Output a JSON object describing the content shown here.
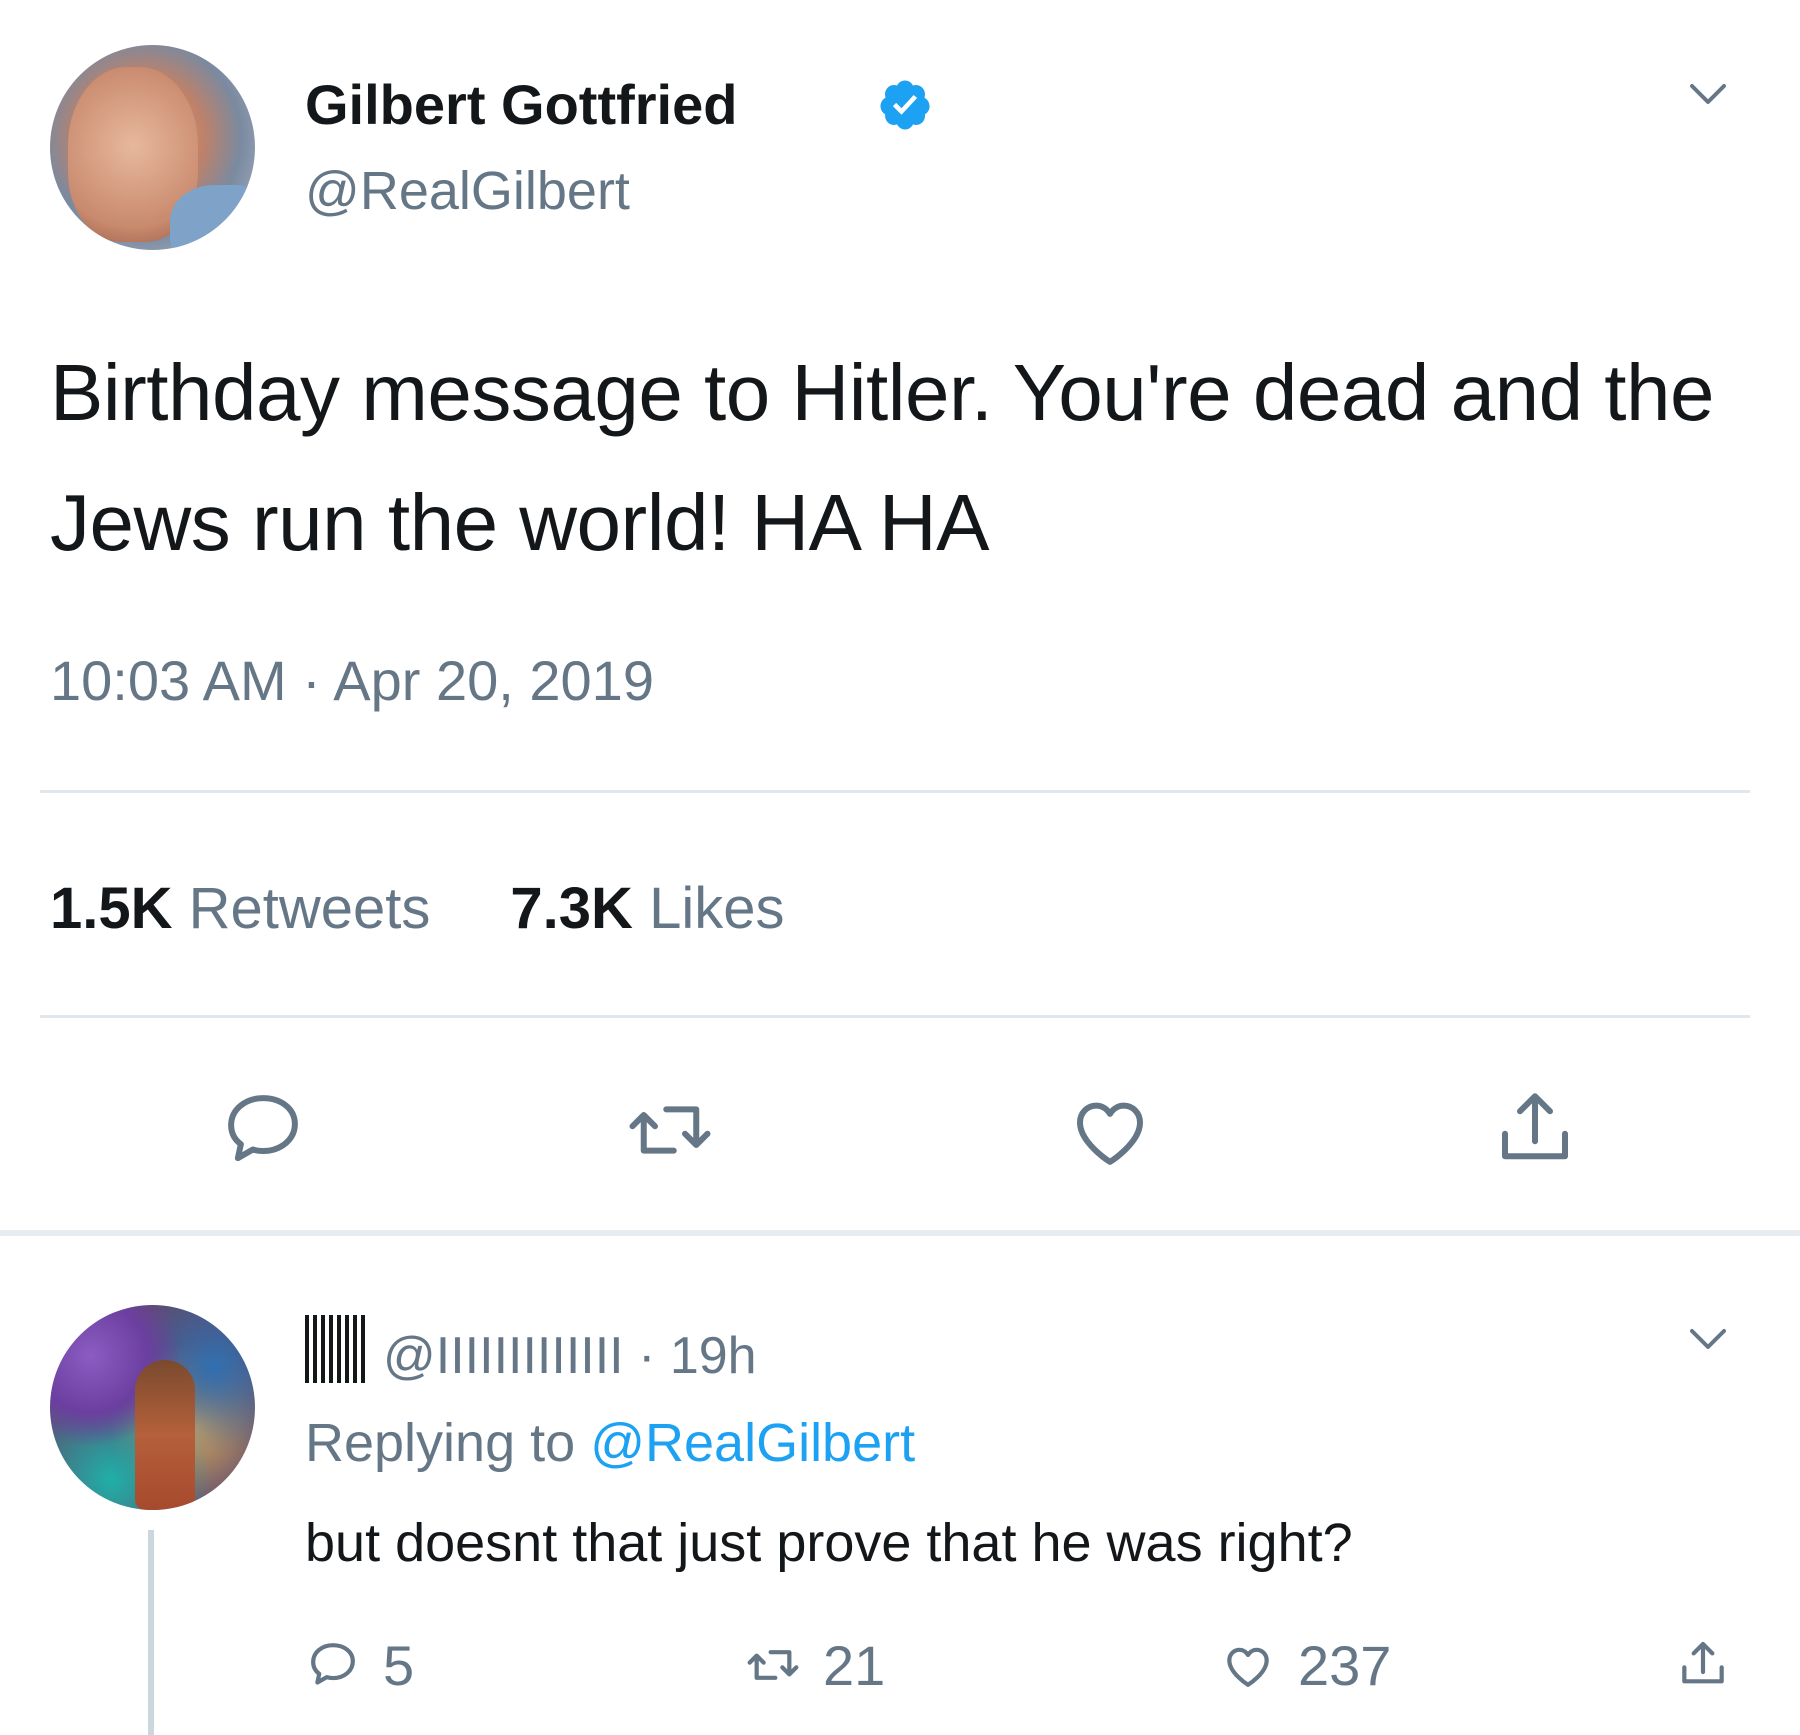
{
  "tweet": {
    "display_name": "Gilbert Gottfried",
    "handle": "@RealGilbert",
    "text": "Birthday message to Hitler. You're dead and the Jews run the world! HA HA",
    "timestamp": "10:03 AM · Apr 20, 2019",
    "retweets_count": "1.5K",
    "retweets_label": "Retweets",
    "likes_count": "7.3K",
    "likes_label": "Likes"
  },
  "reply": {
    "handle": "@IIIIIIIIIIIII",
    "time": "· 19h",
    "replying_prefix": "Replying to",
    "replying_mention": "@RealGilbert",
    "text": "but doesnt that just prove that he was right?",
    "reply_count": "5",
    "retweet_count": "21",
    "like_count": "237"
  },
  "colors": {
    "accent": "#1da1f2",
    "secondary_text": "#657786",
    "primary_text": "#14171a",
    "divider": "#e1e8ed"
  },
  "icons": {
    "verified": "verified-badge-icon",
    "caret": "chevron-down-icon",
    "reply": "speech-bubble-icon",
    "retweet": "retweet-arrows-icon",
    "like": "heart-icon",
    "share": "share-upload-icon"
  }
}
